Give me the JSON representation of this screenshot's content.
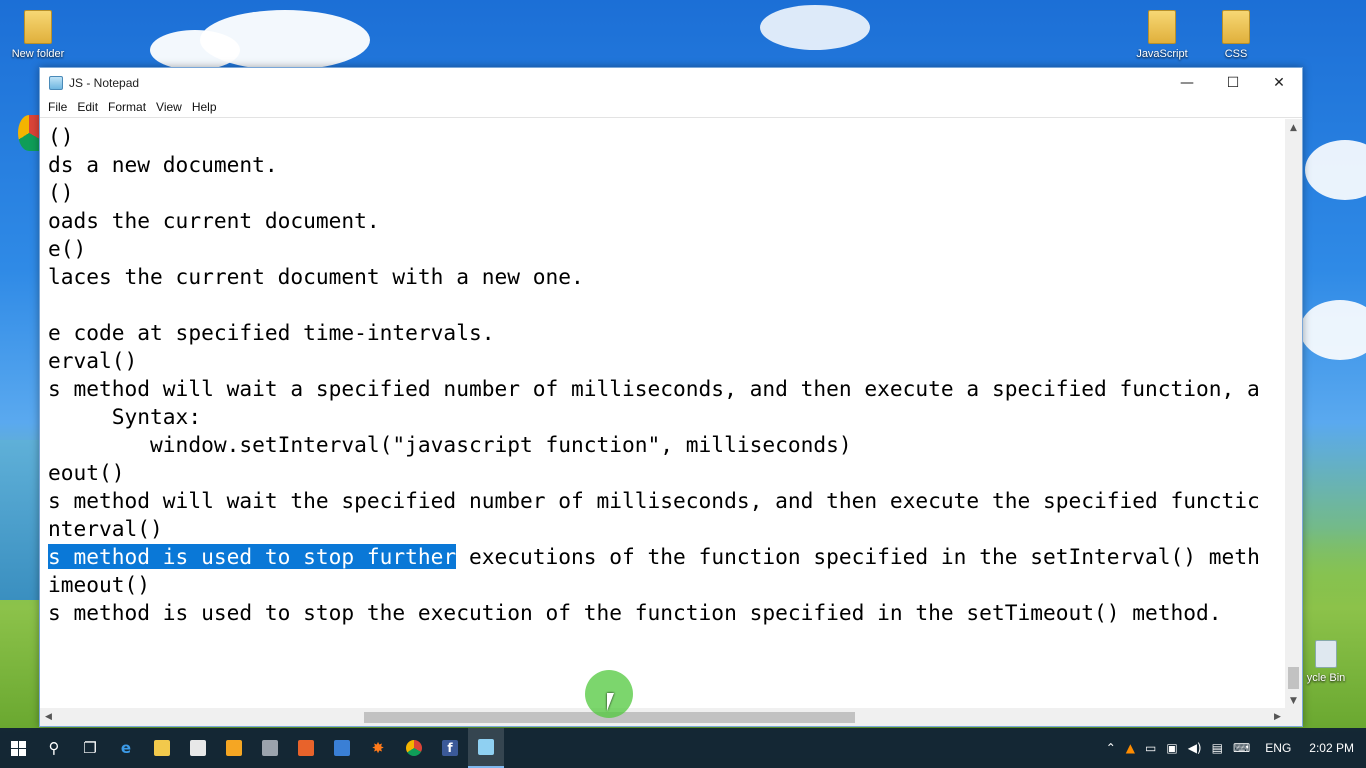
{
  "desktop": {
    "icons": [
      {
        "label": "New folder"
      },
      {
        "label": "JavaScript"
      },
      {
        "label": "CSS"
      },
      {
        "label": "ycle Bin"
      }
    ]
  },
  "window": {
    "title": "JS - Notepad",
    "controls": {
      "minimize": "—",
      "maximize": "☐",
      "close": "✕"
    }
  },
  "menu": [
    "File",
    "Edit",
    "Format",
    "View",
    "Help"
  ],
  "editor": {
    "lines": [
      "()",
      "ds a new document.",
      "()",
      "oads the current document.",
      "e()",
      "laces the current document with a new one.",
      "",
      "e code at specified time-intervals.",
      "erval()",
      "s method will wait a specified number of milliseconds, and then execute a specified function, a",
      "     Syntax:",
      "        window.setInterval(\"javascript function\", milliseconds)",
      "eout()",
      "s method will wait the specified number of milliseconds, and then execute the specified functic",
      "nterval()",
      "",
      "imeout()",
      "s method is used to stop the execution of the function specified in the setTimeout() method."
    ],
    "selected_line": {
      "selected": "s method is used to stop further",
      "rest": " executions of the function specified in the setInterval() meth"
    },
    "selection_color": "#0a78d7"
  },
  "taskbar": {
    "apps": [
      "windows-start-icon",
      "search-icon",
      "task-view-icon",
      "edge-icon",
      "file-explorer-icon",
      "store-icon",
      "media-player-icon",
      "film-icon",
      "fox-app-icon",
      "panel-icon",
      "paint-icon",
      "chrome-icon",
      "facebook-icon",
      "notepad-icon"
    ],
    "tray": {
      "language": "ENG",
      "time": "2:02 PM"
    }
  }
}
